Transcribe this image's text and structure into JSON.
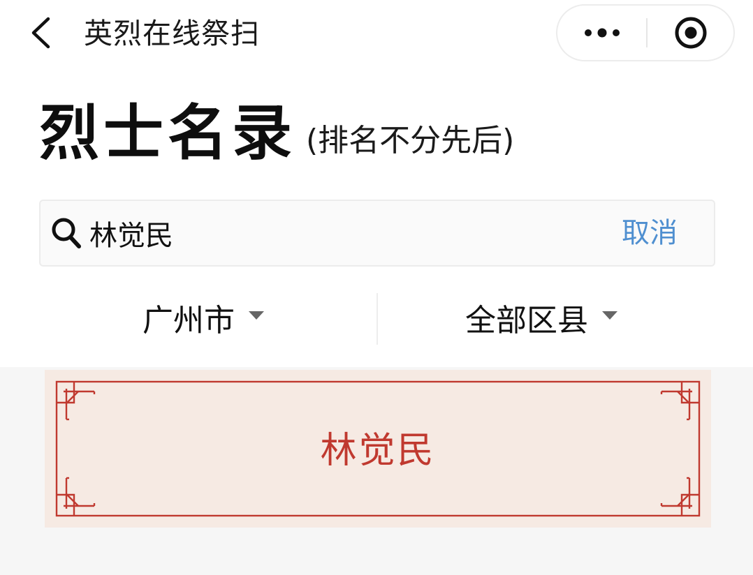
{
  "nav": {
    "title": "英烈在线祭扫",
    "back_icon": "chevron-left-icon",
    "more_icon": "more-dots-icon",
    "close_icon": "target-circle-icon"
  },
  "heading": {
    "title": "烈士名录",
    "subtitle": "(排名不分先后)"
  },
  "search": {
    "value": "林觉民",
    "cancel_label": "取消",
    "icon": "search-icon"
  },
  "filters": {
    "city": "广州市",
    "district": "全部区县",
    "dropdown_icon": "caret-down-icon"
  },
  "results": [
    {
      "name": "林觉民"
    }
  ],
  "colors": {
    "accent_link": "#4f8fd0",
    "card_red": "#c0392f",
    "card_bg": "#f6eae3",
    "results_bg": "#f6f6f6"
  }
}
